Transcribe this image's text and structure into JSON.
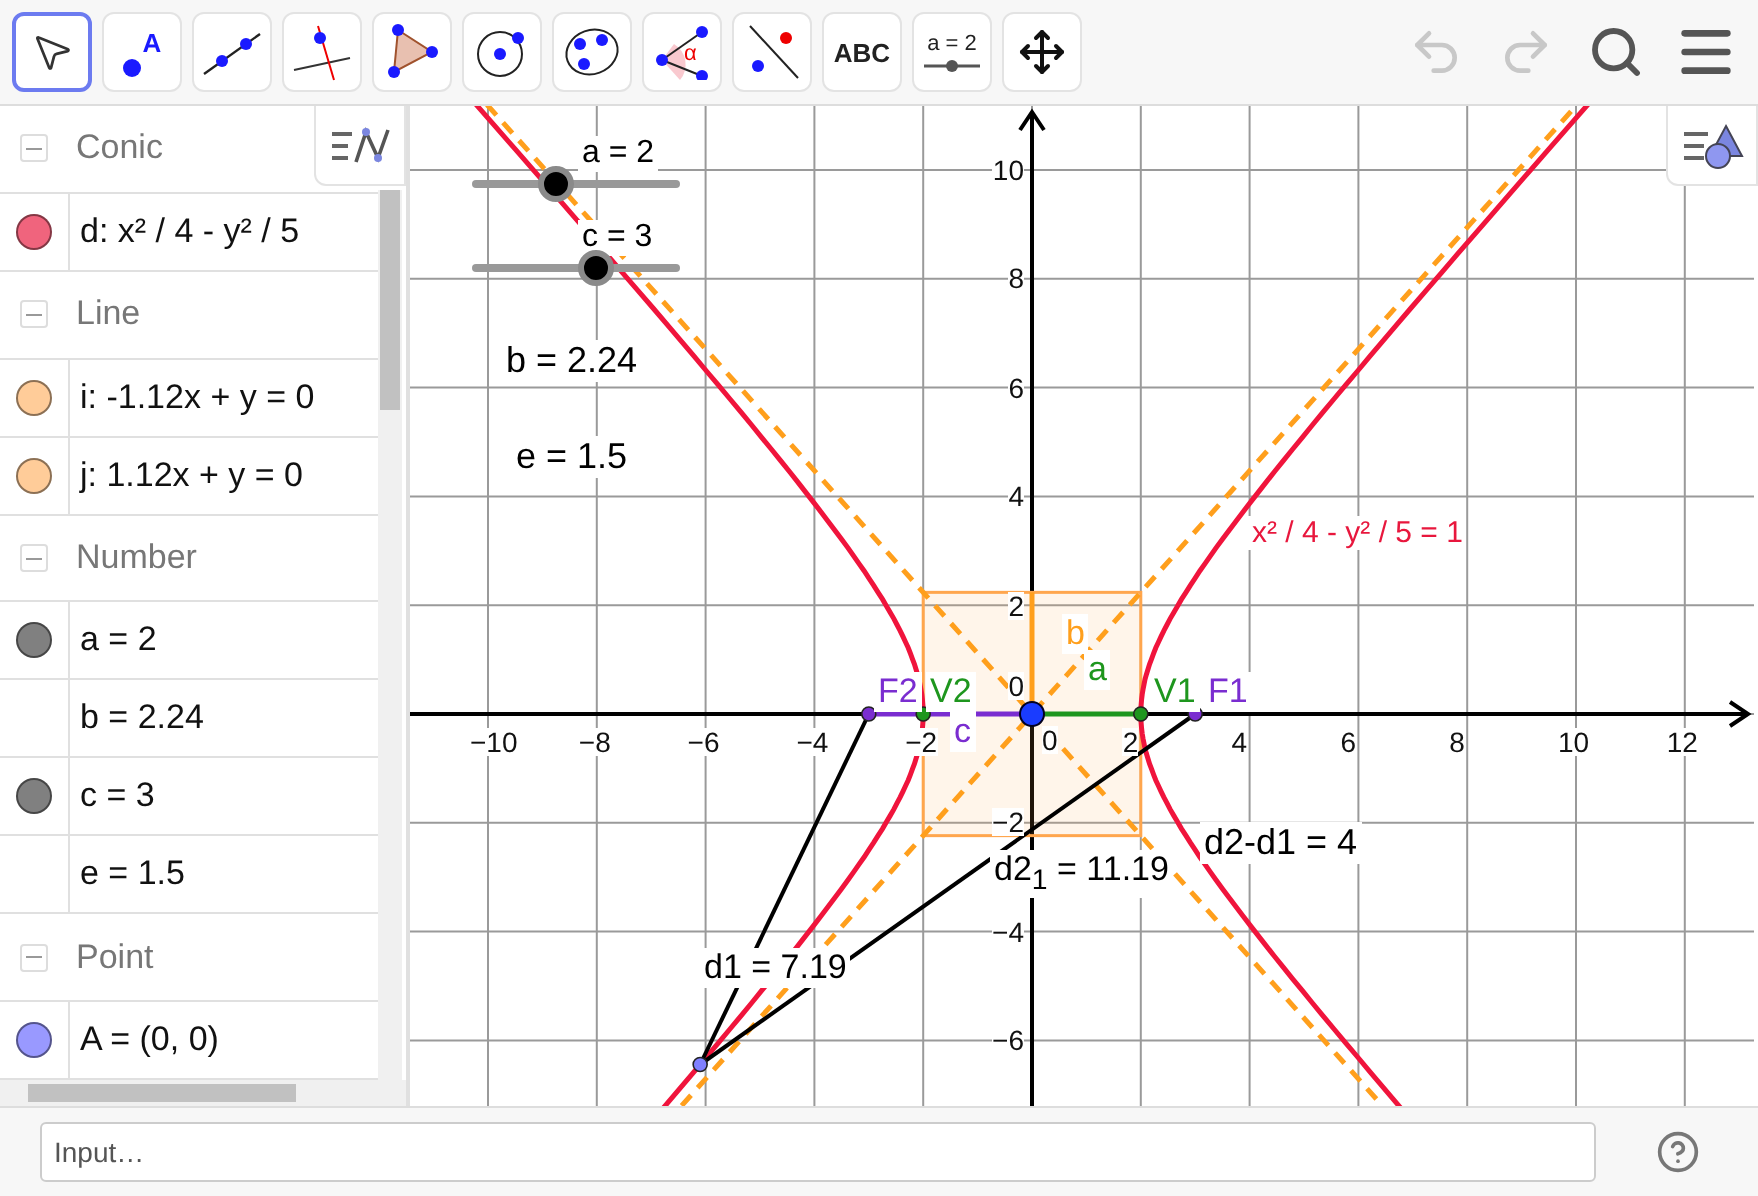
{
  "toolbar": {
    "tools": [
      {
        "kind": "move",
        "selected": true
      },
      {
        "kind": "point",
        "label": "A",
        "selected": false
      },
      {
        "kind": "line",
        "selected": false
      },
      {
        "kind": "perpendicular",
        "selected": false
      },
      {
        "kind": "polygon",
        "selected": false
      },
      {
        "kind": "circle",
        "selected": false
      },
      {
        "kind": "conic",
        "selected": false
      },
      {
        "kind": "angle",
        "label": "α",
        "selected": false
      },
      {
        "kind": "reflect",
        "selected": false
      },
      {
        "kind": "text",
        "label": "ABC",
        "selected": false
      },
      {
        "kind": "slider",
        "label": "a = 2",
        "selected": false
      },
      {
        "kind": "move-view",
        "selected": false
      }
    ],
    "actions": [
      {
        "kind": "undo",
        "disabled": true
      },
      {
        "kind": "redo",
        "disabled": true
      },
      {
        "kind": "search",
        "disabled": false
      },
      {
        "kind": "menu",
        "disabled": false
      }
    ]
  },
  "algebra": {
    "groups": [
      {
        "label": "Conic",
        "expanded": true,
        "items": [
          {
            "text": "d: x² / 4 - y² / 5",
            "color": "#f0647d"
          }
        ]
      },
      {
        "label": "Line",
        "expanded": true,
        "items": [
          {
            "text": "i: -1.12x + y = 0",
            "color": "#ffcc99"
          },
          {
            "text": "j: 1.12x + y = 0",
            "color": "#ffcc99"
          }
        ]
      },
      {
        "label": "Number",
        "expanded": true,
        "items": [
          {
            "text": "a = 2",
            "color": "#808080"
          },
          {
            "text": "b = 2.24"
          },
          {
            "text": "c = 3",
            "color": "#808080"
          },
          {
            "text": "e = 1.5"
          }
        ]
      },
      {
        "label": "Point",
        "expanded": true,
        "items": [
          {
            "text": "A = (0, 0)",
            "color": "#9999ff"
          }
        ]
      }
    ]
  },
  "graphics": {
    "sliders": [
      {
        "label": "a = 2",
        "level": 0.4
      },
      {
        "label": "c = 3",
        "level": 0.6
      }
    ],
    "x_ticks": [
      "−10",
      "−8",
      "−6",
      "−4",
      "−2",
      "0",
      "2",
      "4",
      "6",
      "8",
      "10",
      "12"
    ],
    "y_ticks": [
      "10",
      "8",
      "6",
      "4",
      "2",
      "0",
      "−2",
      "−4",
      "−6"
    ],
    "labels": [
      {
        "text": "b = 2.24",
        "color": "#000000"
      },
      {
        "text": "e = 1.5",
        "color": "#000000"
      },
      {
        "text": "x² / 4 - y² / 5 = 1",
        "color": "#e8173d"
      },
      {
        "text": "F2",
        "color": "#7a2dd0"
      },
      {
        "text": "V2",
        "color": "#1e961e"
      },
      {
        "text": "V1",
        "color": "#1e961e"
      },
      {
        "text": "F1",
        "color": "#7a2dd0"
      },
      {
        "text": "a",
        "color": "#1e961e"
      },
      {
        "text": "b",
        "color": "#ff9f1c"
      },
      {
        "text": "c",
        "color": "#7a2dd0"
      },
      {
        "text": "d2-d1 = 4",
        "color": "#000000"
      },
      {
        "text": "d2$_{1}$ = 11.19",
        "color": "#000000"
      },
      {
        "text": "d1 = 7.19",
        "color": "#000000"
      }
    ]
  },
  "input_bar": {
    "placeholder": "Input…"
  }
}
